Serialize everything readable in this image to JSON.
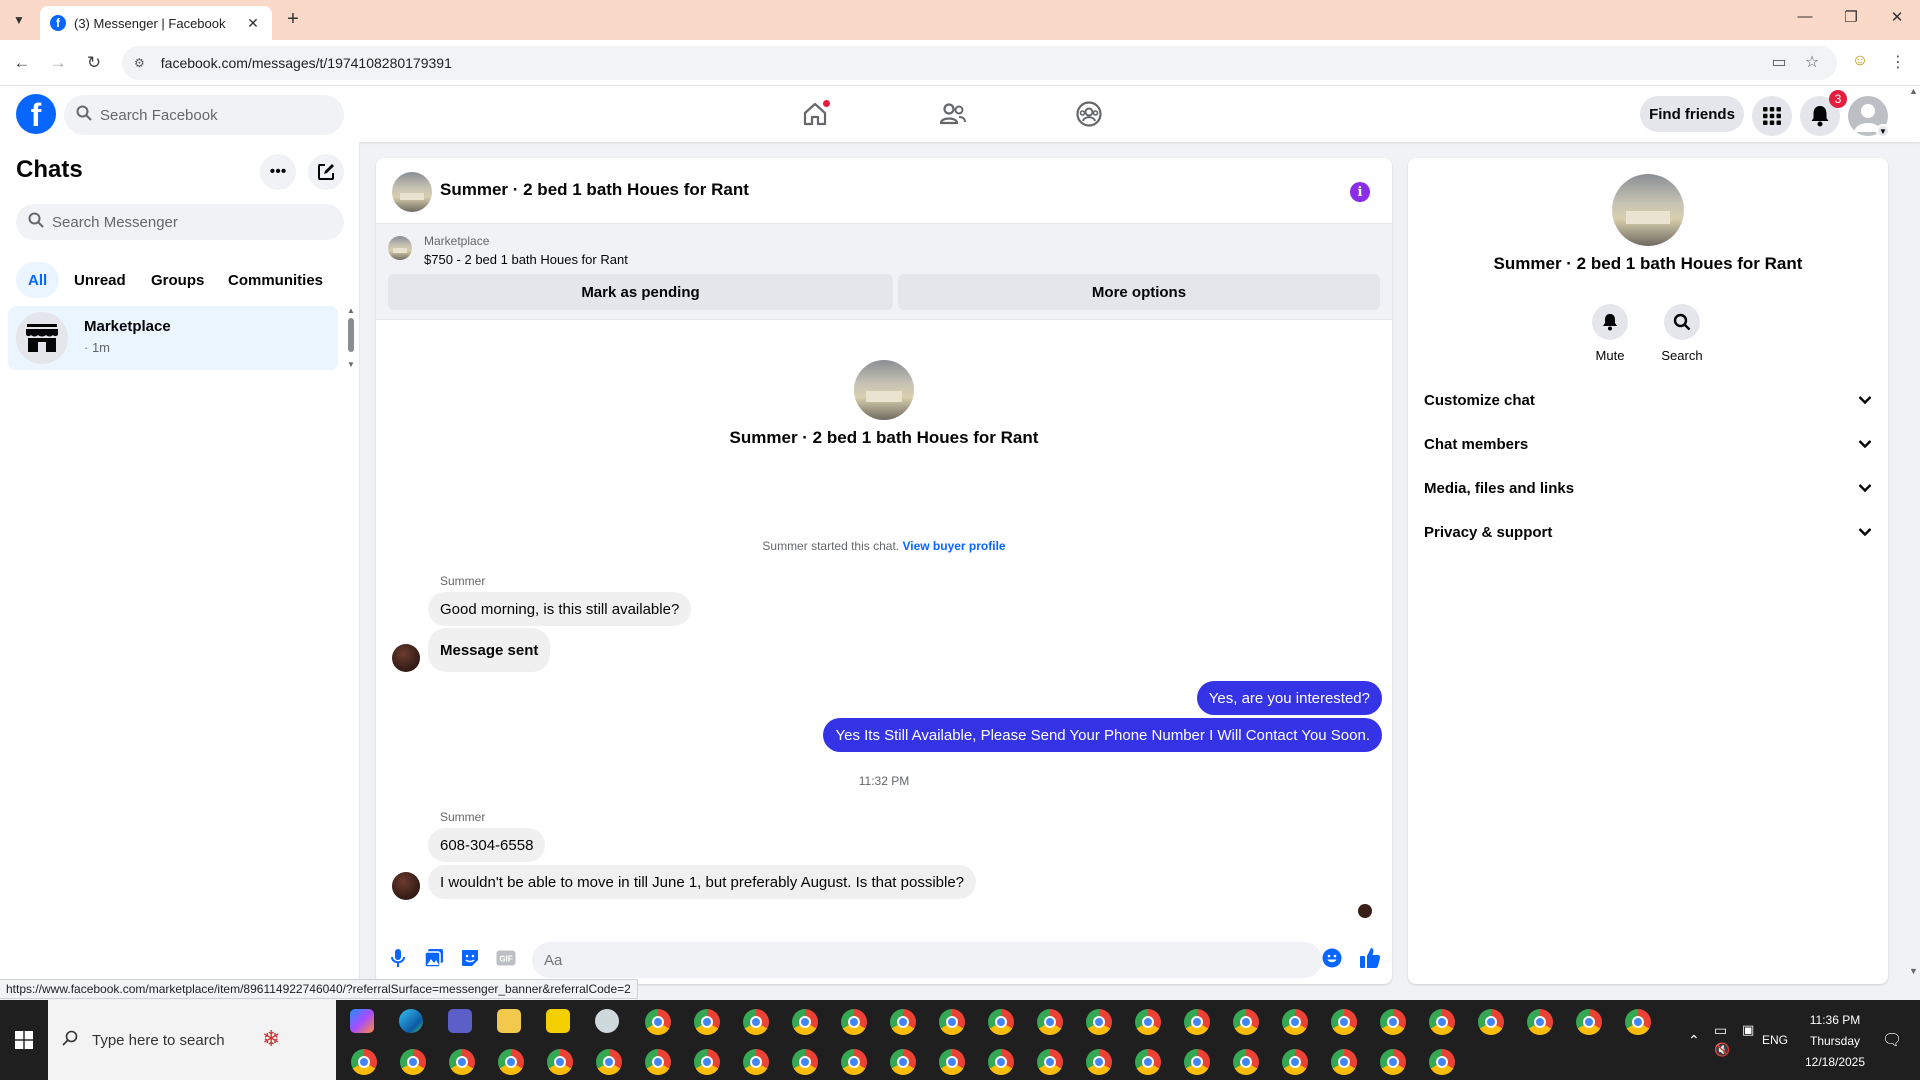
{
  "browser": {
    "tab_title": "(3) Messenger | Facebook",
    "url": "facebook.com/messages/t/1974108280179391",
    "status_url": "https://www.facebook.com/marketplace/item/896114922746040/?referralSurface=messenger_banner&referralCode=2"
  },
  "fb": {
    "search_placeholder": "Search Facebook",
    "find_friends": "Find friends",
    "notification_count": "3"
  },
  "sidebar": {
    "title": "Chats",
    "search_placeholder": "Search Messenger",
    "filters": [
      "All",
      "Unread",
      "Groups",
      "Communities"
    ],
    "chats": [
      {
        "name": "Marketplace",
        "time": "· 1m"
      }
    ]
  },
  "conversation": {
    "title": "Summer · 2 bed 1 bath Houes for Rant",
    "marketplace_label": "Marketplace",
    "listing": "$750 - 2 bed 1 bath Houes for Rant",
    "mark_pending": "Mark as pending",
    "more_options": "More options",
    "started_text": "Summer started this chat.",
    "view_buyer_profile": "View buyer profile",
    "sender_name": "Summer",
    "messages_in_1": [
      "Good morning, is this still available?",
      "Message sent"
    ],
    "messages_out": [
      "Yes, are you interested?",
      "Yes Its Still Available, Please Send Your Phone Number I Will Contact You Soon."
    ],
    "timestamp": "11:32 PM",
    "messages_in_2": [
      "608-304-6558",
      "I wouldn't be able to move in till June 1, but preferably August. Is that possible?"
    ],
    "composer_placeholder": "Aa"
  },
  "details": {
    "name": "Summer · 2 bed 1 bath Houes for Rant",
    "actions": [
      "Mute",
      "Search"
    ],
    "sections": [
      "Customize chat",
      "Chat members",
      "Media, files and links",
      "Privacy & support"
    ]
  },
  "taskbar": {
    "search_placeholder": "Type here to search",
    "language": "ENG",
    "time": "11:36 PM",
    "day": "Thursday",
    "date": "12/18/2025"
  },
  "colors": {
    "fb_blue": "#0866ff",
    "outgoing_bubble": "#3533e6",
    "info_purple": "#8b2ce8",
    "badge_red": "#e41e3f"
  }
}
